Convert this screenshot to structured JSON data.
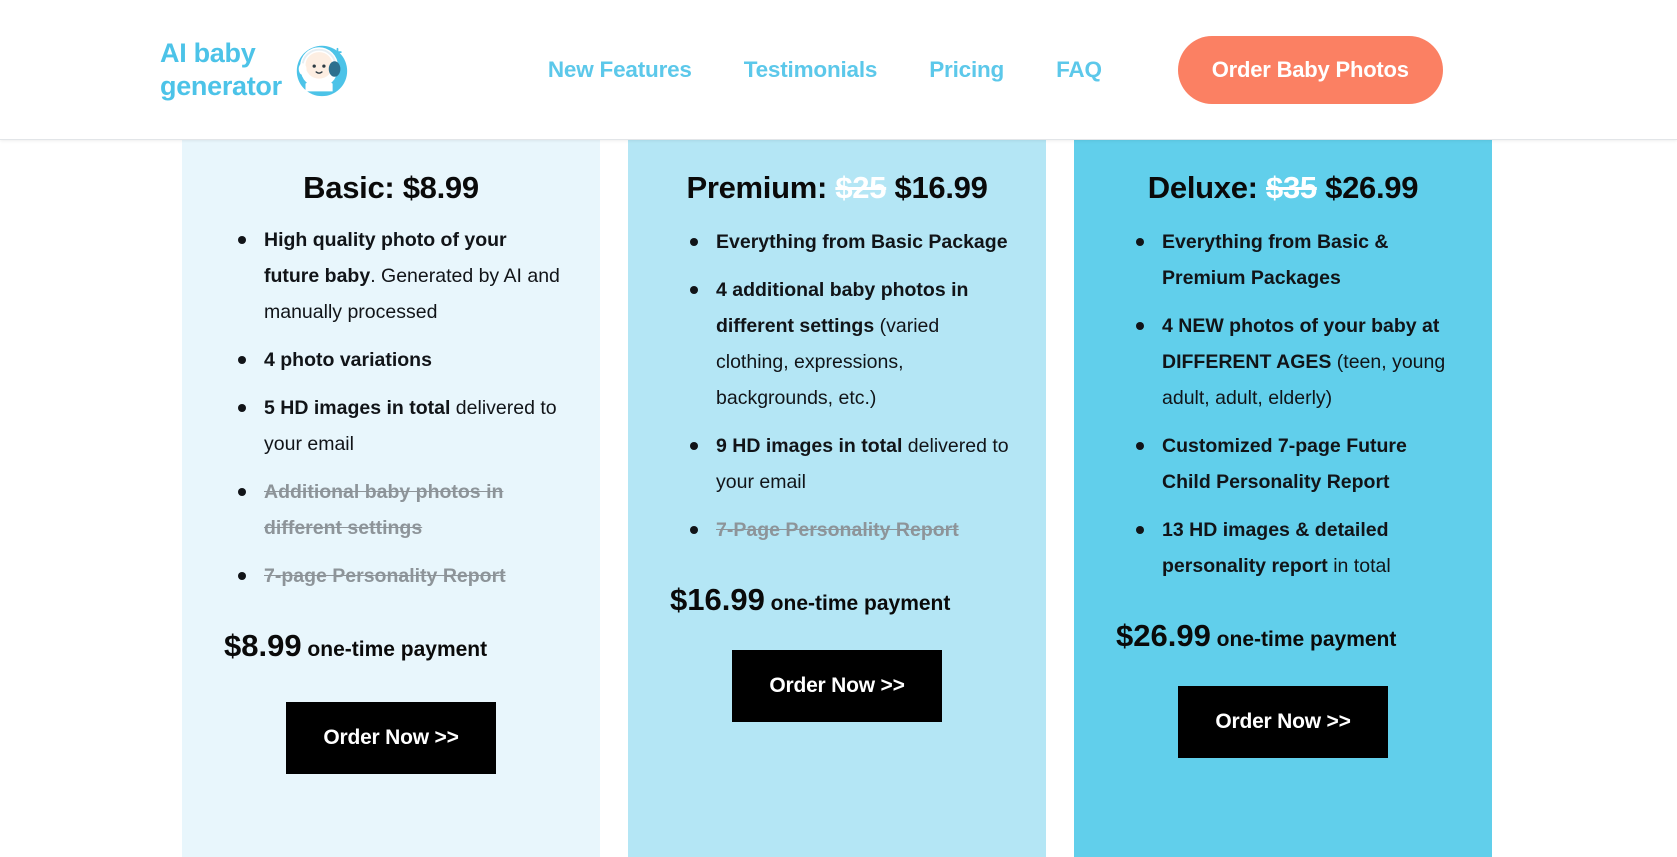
{
  "header": {
    "brand": {
      "line1": "AI baby",
      "line2": "generator",
      "logo_icon": "baby-with-headphones-logo"
    },
    "nav": [
      {
        "label": "New Features"
      },
      {
        "label": "Testimonials"
      },
      {
        "label": "Pricing"
      },
      {
        "label": "FAQ"
      }
    ],
    "cta": {
      "label": "Order Baby Photos",
      "color": "#fb8063"
    }
  },
  "pricing": {
    "plans": [
      {
        "id": "basic",
        "title_prefix": "Basic: ",
        "old_price": "",
        "price": "$8.99",
        "bg_color": "#e8f6fc",
        "features": [
          {
            "bold": "High quality photo of your future baby",
            "rest": ". Generated by AI and manually processed",
            "disabled": false
          },
          {
            "bold": "4 photo variations",
            "rest": "",
            "disabled": false
          },
          {
            "bold": "5 HD images in total",
            "rest": " delivered to your email",
            "disabled": false
          },
          {
            "bold": "Additional baby photos in different settings",
            "rest": "",
            "disabled": true
          },
          {
            "bold": "7-page Personality Report",
            "rest": "",
            "disabled": true
          }
        ],
        "price_amount": "$8.99",
        "price_suffix": " one-time payment",
        "order_label": "Order Now >>"
      },
      {
        "id": "premium",
        "title_prefix": "Premium: ",
        "old_price": "$25",
        "price": "$16.99",
        "bg_color": "#b4e6f5",
        "features": [
          {
            "bold": "Everything from Basic Package",
            "rest": "",
            "disabled": false
          },
          {
            "bold": "4 additional baby photos in different settings",
            "rest": " (varied clothing, expressions, backgrounds, etc.)",
            "disabled": false
          },
          {
            "bold": "9 HD images in total",
            "rest": " delivered to your email",
            "disabled": false
          },
          {
            "bold": "7-Page Personality Report",
            "rest": "",
            "disabled": true
          }
        ],
        "price_amount": "$16.99",
        "price_suffix": " one-time payment",
        "order_label": "Order Now >>"
      },
      {
        "id": "deluxe",
        "title_prefix": "Deluxe: ",
        "old_price": "$35",
        "price": "$26.99",
        "bg_color": "#61cfeb",
        "features": [
          {
            "bold": "Everything from Basic & Premium Packages",
            "rest": "",
            "disabled": false
          },
          {
            "bold": "4 NEW photos of your baby at DIFFERENT AGES",
            "rest": " (teen, young adult, adult, elderly)",
            "disabled": false
          },
          {
            "bold": "Customized 7-page Future Child Personality Report",
            "rest": "",
            "disabled": false
          },
          {
            "bold": "13 HD images & detailed personality report",
            "rest": " in total",
            "disabled": false
          }
        ],
        "price_amount": "$26.99",
        "price_suffix": " one-time payment",
        "order_label": "Order Now >>"
      }
    ]
  }
}
